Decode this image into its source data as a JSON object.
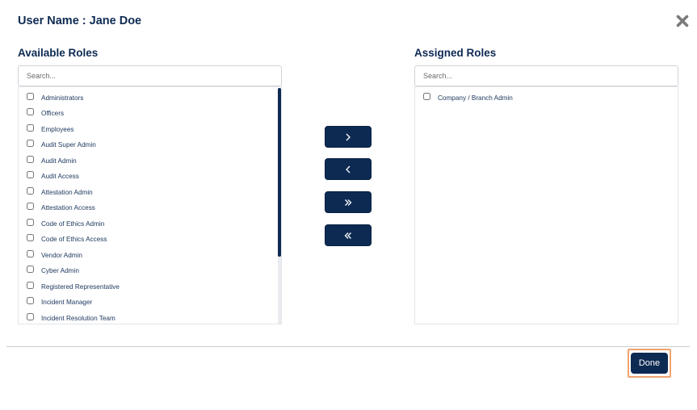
{
  "dialog": {
    "title": "User Name : Jane Doe",
    "close_icon": "close-icon"
  },
  "available": {
    "heading": "Available Roles",
    "search_placeholder": "Search...",
    "items": [
      {
        "label": "Administrators",
        "checked": false
      },
      {
        "label": "Officers",
        "checked": false
      },
      {
        "label": "Employees",
        "checked": false
      },
      {
        "label": "Audit Super Admin",
        "checked": false
      },
      {
        "label": "Audit Admin",
        "checked": false
      },
      {
        "label": "Audit Access",
        "checked": false
      },
      {
        "label": "Attestation Admin",
        "checked": false
      },
      {
        "label": "Attestation Access",
        "checked": false
      },
      {
        "label": "Code of Ethics Admin",
        "checked": false
      },
      {
        "label": "Code of Ethics Access",
        "checked": false
      },
      {
        "label": "Vendor Admin",
        "checked": false
      },
      {
        "label": "Cyber Admin",
        "checked": false
      },
      {
        "label": "Registered Representative",
        "checked": false
      },
      {
        "label": "Incident Manager",
        "checked": false
      },
      {
        "label": "Incident Resolution Team",
        "checked": false
      }
    ]
  },
  "assigned": {
    "heading": "Assigned Roles",
    "search_placeholder": "Search...",
    "items": [
      {
        "label": "Company / Branch Admin",
        "checked": false
      }
    ]
  },
  "transfer_buttons": [
    {
      "icon": "chevron-right-icon"
    },
    {
      "icon": "chevron-left-icon"
    },
    {
      "icon": "double-chevron-right-icon"
    },
    {
      "icon": "double-chevron-left-icon"
    }
  ],
  "footer": {
    "done_label": "Done"
  },
  "colors": {
    "primary": "#0d2a52",
    "focus_outline": "#f0a36e"
  }
}
